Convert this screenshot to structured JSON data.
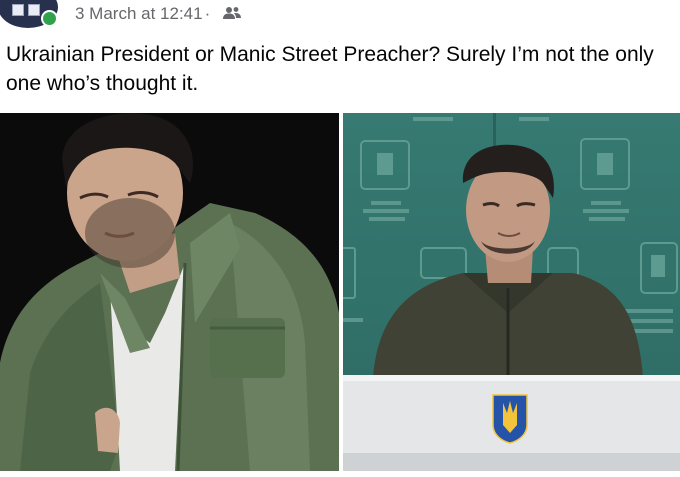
{
  "post": {
    "timestamp": "3 March at 12:41",
    "separator": "·",
    "audience_icon": "friends-icon",
    "text": "Ukrainian President or Manic Street Preacher? Surely I’m not the only one who’s thought it."
  },
  "images": [
    {
      "name": "photo-man-green-jacket"
    },
    {
      "name": "photo-man-at-podium"
    }
  ],
  "colors": {
    "online_status": "#31a24c",
    "meta_text": "#65676b",
    "body_text": "#050505",
    "backdrop_green": "#2f6f68"
  }
}
